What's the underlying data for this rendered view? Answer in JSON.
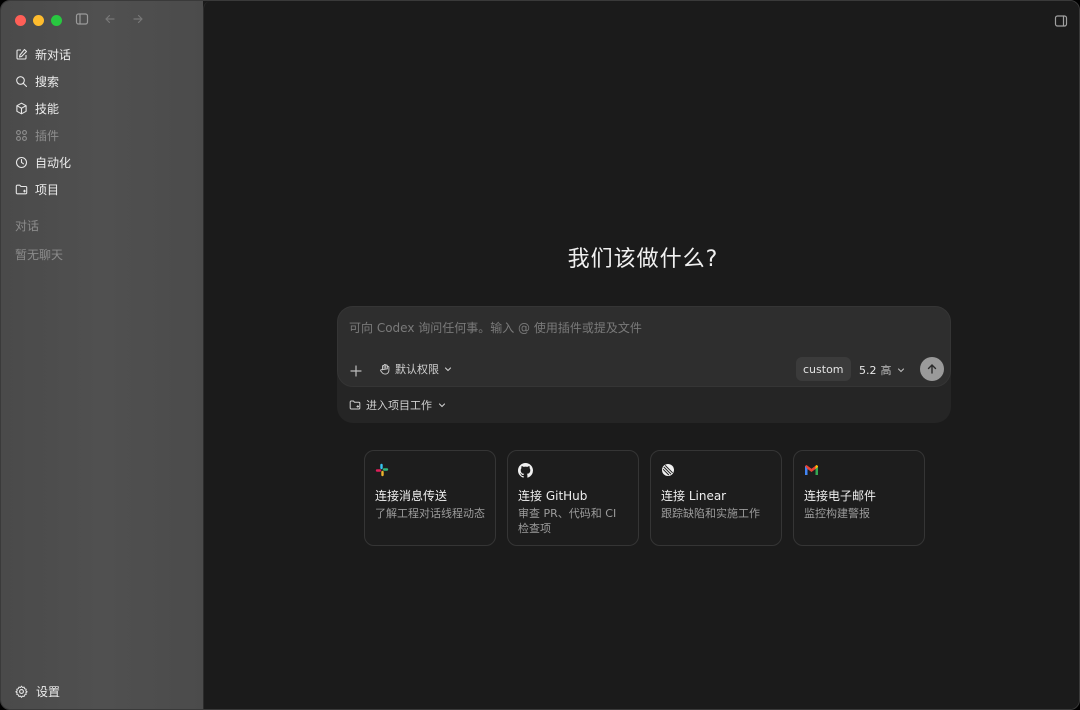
{
  "sidebar": {
    "items": [
      {
        "label": "新对话",
        "icon": "compose-icon"
      },
      {
        "label": "搜索",
        "icon": "search-icon"
      },
      {
        "label": "技能",
        "icon": "cube-icon"
      },
      {
        "label": "插件",
        "icon": "grid-icon"
      },
      {
        "label": "自动化",
        "icon": "clock-icon"
      },
      {
        "label": "项目",
        "icon": "folder-icon"
      }
    ],
    "section_label": "对话",
    "empty_text": "暂无聊天",
    "settings_label": "设置"
  },
  "main": {
    "headline": "我们该做什么?",
    "composer": {
      "placeholder": "可向 Codex 询问任何事。输入 @ 使用插件或提及文件",
      "value": "",
      "permission_label": "默认权限",
      "custom_label": "custom",
      "model_version": "5.2",
      "model_level": "高",
      "project_label": "进入项目工作"
    },
    "cards": [
      {
        "title": "连接消息传送",
        "desc": "了解工程对话线程动态",
        "icon": "slack-icon"
      },
      {
        "title": "连接 GitHub",
        "desc": "审查 PR、代码和 CI 检查项",
        "icon": "github-icon"
      },
      {
        "title": "连接 Linear",
        "desc": "跟踪缺陷和实施工作",
        "icon": "linear-icon"
      },
      {
        "title": "连接电子邮件",
        "desc": "监控构建警报",
        "icon": "gmail-icon"
      }
    ]
  },
  "colors": {
    "traffic_red": "#ff5f57",
    "traffic_yellow": "#febc2e",
    "traffic_green": "#28c840",
    "gmail_red": "#ea4335",
    "gmail_blue": "#4285f4"
  }
}
